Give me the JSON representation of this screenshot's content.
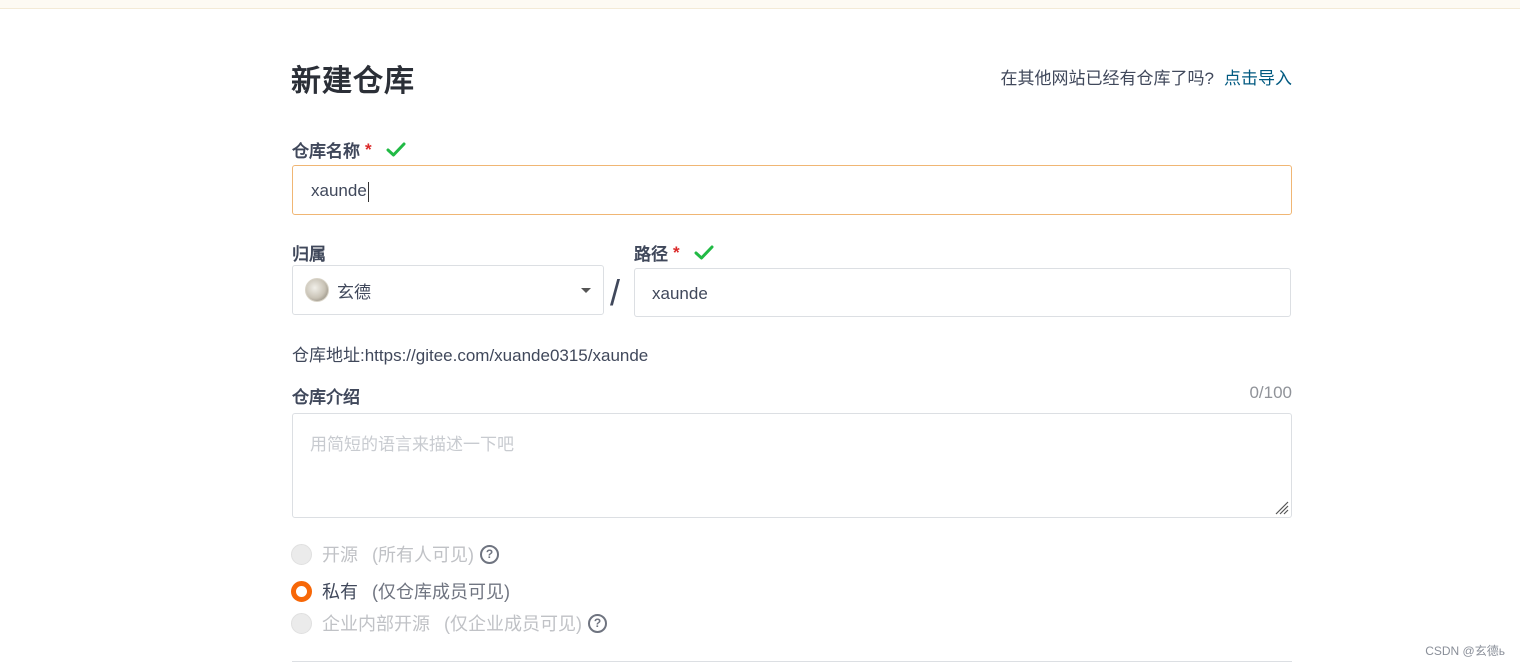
{
  "header": {
    "title": "新建仓库",
    "import_hint": "在其他网站已经有仓库了吗?",
    "import_link": "点击导入"
  },
  "repo_name": {
    "label": "仓库名称",
    "required_mark": "*",
    "value": "xaunde"
  },
  "owner": {
    "label": "归属",
    "value": "玄德"
  },
  "separator": "/",
  "path": {
    "label": "路径",
    "required_mark": "*",
    "value": "xaunde"
  },
  "repo_address": "仓库地址:https://gitee.com/xuande0315/xaunde",
  "description": {
    "label": "仓库介绍",
    "counter": "0/100",
    "placeholder": "用简短的语言来描述一下吧"
  },
  "visibility": [
    {
      "label": "开源",
      "sub": "(所有人可见)",
      "state": "disabled",
      "help": "?"
    },
    {
      "label": "私有",
      "sub": "(仅仓库成员可见)",
      "state": "checked"
    },
    {
      "label": "企业内部开源",
      "sub": "(仅企业成员可见)",
      "state": "disabled",
      "help": "?"
    }
  ],
  "watermark": "CSDN @玄德ь",
  "colors": {
    "accent": "#f76707",
    "link": "#005980",
    "required": "#db2828",
    "valid": "#21ba45",
    "input_focus_border": "#f0b674"
  }
}
